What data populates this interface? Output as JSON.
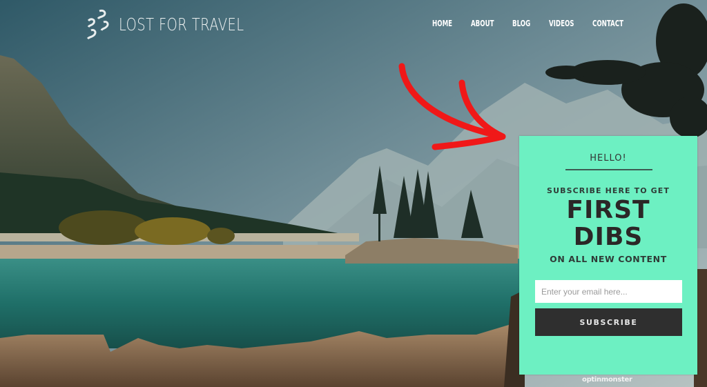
{
  "site": {
    "logo_text": "LOST FOR TRAVEL",
    "logo_icon": "footprints-icon"
  },
  "nav": {
    "items": [
      {
        "label": "HOME"
      },
      {
        "label": "ABOUT"
      },
      {
        "label": "BLOG"
      },
      {
        "label": "VIDEOS"
      },
      {
        "label": "CONTACT"
      }
    ]
  },
  "hero": {
    "description": "Mountain lake landscape with small pine-tree island, rocky foreground and tree branches",
    "annotation": "red-arrow-icon"
  },
  "popup": {
    "greeting": "HELLO!",
    "kicker": "SUBSCRIBE HERE TO GET",
    "headline_line1": "FIRST",
    "headline_line2": "DIBS",
    "subline": "ON ALL NEW CONTENT",
    "email": {
      "value": "",
      "placeholder": "Enter your email here..."
    },
    "button_label": "SUBSCRIBE",
    "background_color": "#6df0c2",
    "button_color": "#2f2f2f"
  },
  "branding": {
    "label": "optinmonster"
  }
}
